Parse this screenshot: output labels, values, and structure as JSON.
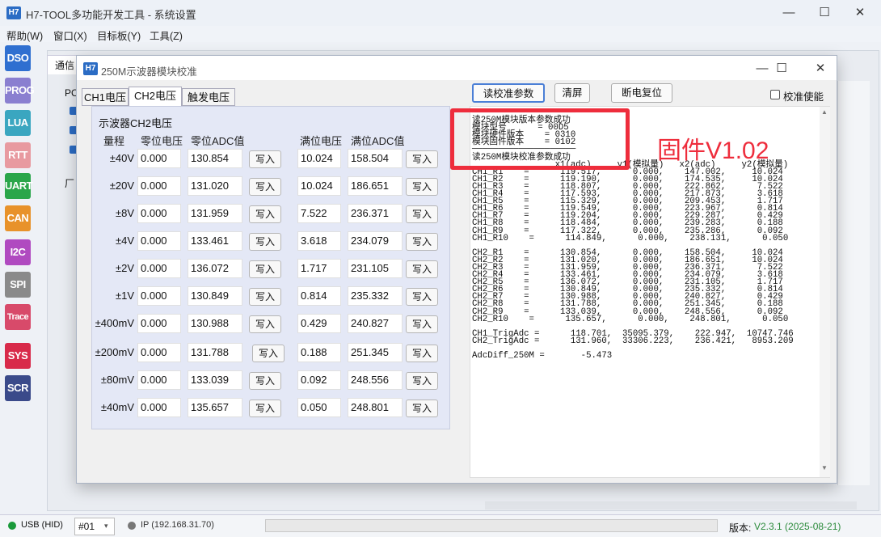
{
  "window": {
    "title": "H7-TOOL多功能开发工具 - 系统设置",
    "icon_text": "H7",
    "controls": [
      "—",
      "☐",
      "✕"
    ]
  },
  "menu": [
    "帮助(W)",
    "窗口(X)",
    "目标板(Y)",
    "工具(Z)"
  ],
  "sidebar": [
    "DSO",
    "PROG",
    "LUA",
    "RTT",
    "UART",
    "CAN",
    "I2C",
    "SPI",
    "Trace",
    "SYS",
    "SCR"
  ],
  "sidebar_colors": [
    "#2f6fd0",
    "#8a7fd0",
    "#3aa6c0",
    "#e89aa0",
    "#2aa64a",
    "#e8922a",
    "#b04ac0",
    "#8a8a8a",
    "#d84a6a",
    "#d82a4a",
    "#3a4a8a"
  ],
  "background": {
    "tab": "通信",
    "labels": [
      "PC",
      "厂"
    ]
  },
  "status": {
    "usb": "USB (HID)",
    "port": "#01",
    "ip": "IP (192.168.31.70)",
    "version_label": "版本:",
    "version": "V2.3.1 (2025-08-21)"
  },
  "dialog": {
    "icon_text": "H7",
    "title": "250M示波器模块校准",
    "tabs": [
      "CH1电压",
      "CH2电压",
      "触发电压"
    ],
    "active_tab": 1,
    "group_title": "示波器CH2电压",
    "headers": {
      "range": "量程",
      "zero": "零位电压",
      "zero_adc": "零位ADC值",
      "full": "满位电压",
      "full_adc": "满位ADC值"
    },
    "write_label": "写入",
    "rows": [
      {
        "range": "±40V",
        "zero": "0.000",
        "zero_adc": "130.854",
        "full": "10.024",
        "full_adc": "158.504"
      },
      {
        "range": "±20V",
        "zero": "0.000",
        "zero_adc": "131.020",
        "full": "10.024",
        "full_adc": "186.651"
      },
      {
        "range": "±8V",
        "zero": "0.000",
        "zero_adc": "131.959",
        "full": "7.522",
        "full_adc": "236.371"
      },
      {
        "range": "±4V",
        "zero": "0.000",
        "zero_adc": "133.461",
        "full": "3.618",
        "full_adc": "234.079"
      },
      {
        "range": "±2V",
        "zero": "0.000",
        "zero_adc": "136.072",
        "full": "1.717",
        "full_adc": "231.105"
      },
      {
        "range": "±1V",
        "zero": "0.000",
        "zero_adc": "130.849",
        "full": "0.814",
        "full_adc": "235.332"
      },
      {
        "range": "±400mV",
        "zero": "0.000",
        "zero_adc": "130.988",
        "full": "0.429",
        "full_adc": "240.827"
      },
      {
        "range": "±200mV",
        "zero": "0.000",
        "zero_adc": "131.788",
        "full": "0.188",
        "full_adc": "251.345"
      },
      {
        "range": "±80mV",
        "zero": "0.000",
        "zero_adc": "133.039",
        "full": "0.092",
        "full_adc": "248.556"
      },
      {
        "range": "±40mV",
        "zero": "0.000",
        "zero_adc": "135.657",
        "full": "0.050",
        "full_adc": "248.801"
      }
    ],
    "toolbar": {
      "read": "读校准参数",
      "clear": "清屏",
      "reset": "断电复位",
      "enable": "校准使能"
    },
    "output_lines": [
      "────────────────────",
      "读250M模块版本参数成功",
      "模块型号      = 00D5",
      "模块硬件版本    = 0310",
      "模块固件版本    = 0102",
      "────────────────────",
      "读250M模块校准参数成功",
      "                x1(adc)     y1(模拟量)   x2(adc)     y2(模拟量)",
      "CH1_R1    =      119.517,      0.000,    147.002,     10.024",
      "CH1_R2    =      119.190,      0.000,    174.535,     10.024",
      "CH1_R3    =      118.807,      0.000,    222.862,      7.522",
      "CH1_R4    =      117.593,      0.000,    217.873,      3.618",
      "CH1_R5    =      115.329,      0.000,    209.453,      1.717",
      "CH1_R6    =      119.549,      0.000,    223.967,      0.814",
      "CH1_R7    =      119.204,      0.000,    229.287,      0.429",
      "CH1_R8    =      118.484,      0.000,    239.283,      0.188",
      "CH1_R9    =      117.322,      0.000,    235.286,      0.092",
      "CH1_R10    =      114.849,      0.000,    238.131,      0.050",
      "",
      "CH2_R1    =      130.854,      0.000,    158.504,     10.024",
      "CH2_R2    =      131.020,      0.000,    186.651,     10.024",
      "CH2_R3    =      131.959,      0.000,    236.371,      7.522",
      "CH2_R4    =      133.461,      0.000,    234.079,      3.618",
      "CH2_R5    =      136.072,      0.000,    231.105,      1.717",
      "CH2_R6    =      130.849,      0.000,    235.332,      0.814",
      "CH2_R7    =      130.988,      0.000,    240.827,      0.429",
      "CH2_R8    =      131.788,      0.000,    251.345,      0.188",
      "CH2_R9    =      133.039,      0.000,    248.556,      0.092",
      "CH2_R10    =      135.657,      0.000,    248.801,      0.050",
      "",
      "CH1_TrigAdc =      118.701,  35095.379,    222.947,  10747.746",
      "CH2_TrigAdc =      131.960,  33306.223,    236.421,   8953.209",
      "",
      "AdcDiff_250M =       -5.473"
    ],
    "annotation": "固件V1.02"
  }
}
